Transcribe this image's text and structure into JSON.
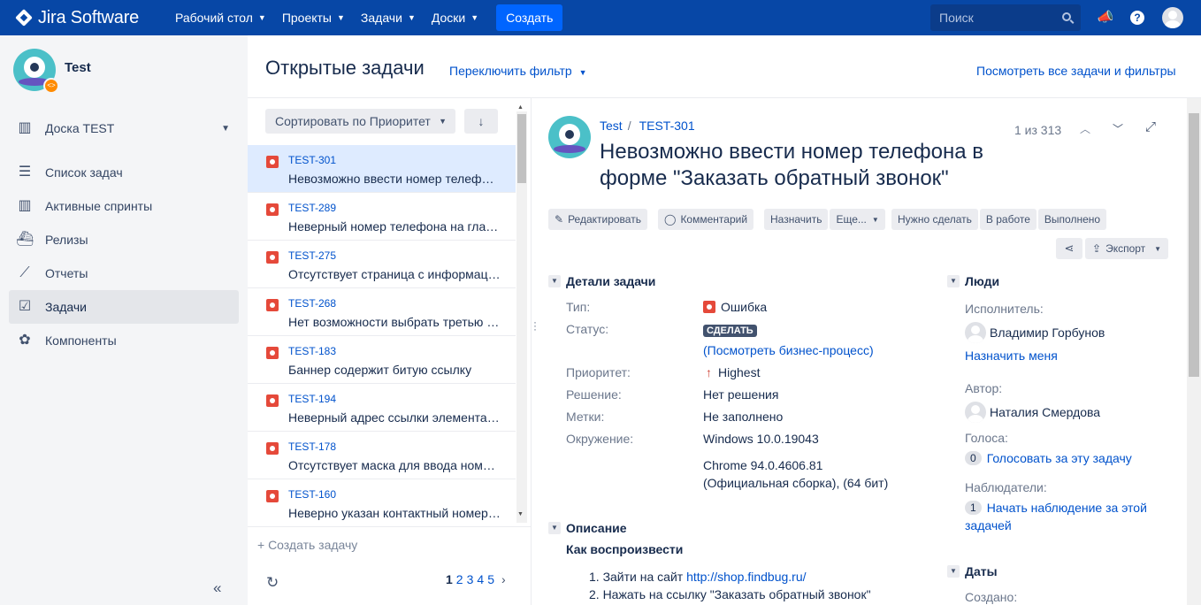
{
  "topnav": {
    "logo": "Jira Software",
    "items": [
      {
        "label": "Рабочий стол"
      },
      {
        "label": "Проекты"
      },
      {
        "label": "Задачи"
      },
      {
        "label": "Доски"
      }
    ],
    "create_label": "Создать",
    "search_placeholder": "Поиск",
    "colors": {
      "nav_bg": "#0747a6",
      "create_bg": "#0065ff"
    }
  },
  "sidebar": {
    "project_name": "Test",
    "items": [
      {
        "label": "Доска TEST",
        "icon": "board-icon"
      },
      {
        "label": "Список задач",
        "icon": "backlog-icon"
      },
      {
        "label": "Активные спринты",
        "icon": "sprints-icon"
      },
      {
        "label": "Релизы",
        "icon": "releases-icon"
      },
      {
        "label": "Отчеты",
        "icon": "reports-icon"
      },
      {
        "label": "Задачи",
        "icon": "issues-icon",
        "active": true
      },
      {
        "label": "Компоненты",
        "icon": "components-icon"
      }
    ]
  },
  "header": {
    "title": "Открытые задачи",
    "switch_filter": "Переключить фильтр",
    "view_all": "Посмотреть все задачи и фильтры"
  },
  "list": {
    "sort_label": "Сортировать по Приоритет",
    "issues": [
      {
        "key": "TEST-301",
        "summary": "Невозможно ввести номер телефона в форме \"Заказать обратный звонок\"",
        "selected": true
      },
      {
        "key": "TEST-289",
        "summary": "Неверный номер телефона на главной странице"
      },
      {
        "key": "TEST-275",
        "summary": "Отсутствует страница с информацией"
      },
      {
        "key": "TEST-268",
        "summary": "Нет возможности выбрать третью позицию"
      },
      {
        "key": "TEST-183",
        "summary": "Баннер содержит битую ссылку"
      },
      {
        "key": "TEST-194",
        "summary": "Неверный адрес ссылки элемента меню"
      },
      {
        "key": "TEST-178",
        "summary": "Отсутствует маска для ввода номера"
      },
      {
        "key": "TEST-160",
        "summary": "Неверно указан контактный номер телефона"
      }
    ],
    "create_issue": "+ Создать задачу",
    "pages": [
      "1",
      "2",
      "3",
      "4",
      "5"
    ]
  },
  "detail": {
    "breadcrumb_project": "Test",
    "breadcrumb_key": "TEST-301",
    "title": "Невозможно ввести номер телефона в форме \"Заказать обратный звонок\"",
    "counter": "1 из 313",
    "actions": {
      "edit": "Редактировать",
      "comment": "Комментарий",
      "assign": "Назначить",
      "more": "Еще...",
      "todo": "Нужно сделать",
      "in_progress": "В работе",
      "done": "Выполнено",
      "export": "Экспорт"
    },
    "details_heading": "Детали задачи",
    "fields": {
      "type_label": "Тип:",
      "type_value": "Ошибка",
      "status_label": "Статус:",
      "status_value": "СДЕЛАТЬ",
      "workflow_link": "(Посмотреть бизнес-процесс)",
      "priority_label": "Приоритет:",
      "priority_value": "Highest",
      "resolution_label": "Решение:",
      "resolution_value": "Нет решения",
      "labels_label": "Метки:",
      "labels_value": "Не заполнено",
      "env_label": "Окружение:",
      "env_value_1": "Windows 10.0.19043",
      "env_value_2": "Chrome 94.0.4606.81",
      "env_value_3": "(Официальная сборка), (64 бит)"
    },
    "description_heading": "Описание",
    "description": {
      "steps_heading": "Как воспроизвести",
      "step1_prefix": "1. Зайти на сайт ",
      "step1_link": "http://shop.findbug.ru/",
      "step2": "2. Нажать на ссылку \"Заказать обратный звонок\""
    },
    "people": {
      "heading": "Люди",
      "assignee_label": "Исполнитель:",
      "assignee": "Владимир Горбунов",
      "assign_me": "Назначить меня",
      "reporter_label": "Автор:",
      "reporter": "Наталия Смердова",
      "votes_label": "Голоса:",
      "votes_count": "0",
      "vote_link": "Голосовать за эту задачу",
      "watchers_label": "Наблюдатели:",
      "watchers_count": "1",
      "watch_link_1": "Начать наблюдение за этой",
      "watch_link_2": "задачей"
    },
    "dates": {
      "heading": "Даты",
      "created_label": "Создано:"
    }
  }
}
